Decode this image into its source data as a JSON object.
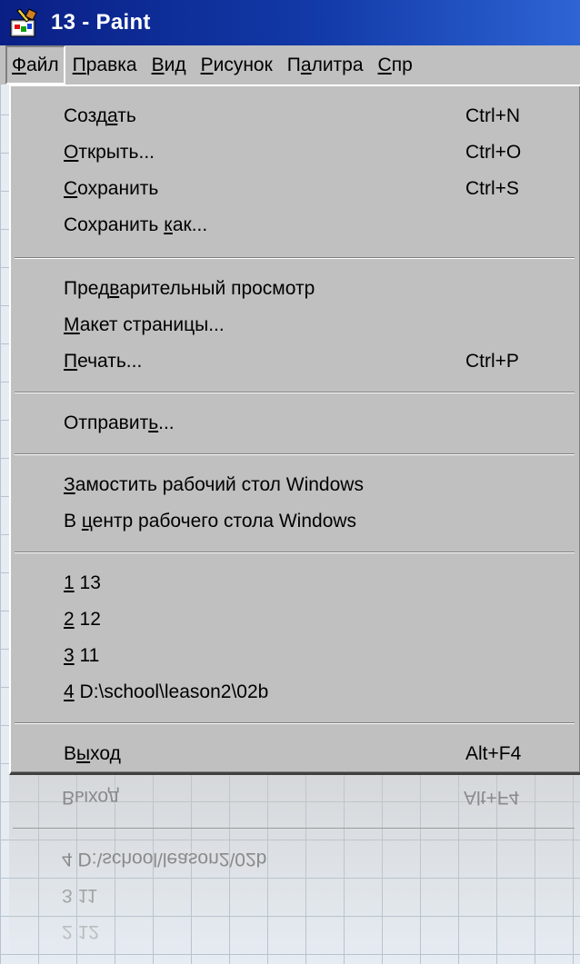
{
  "window": {
    "title": "13 - Paint",
    "icon": "paint-app-icon"
  },
  "menubar": {
    "items": [
      {
        "pre": "",
        "key": "Ф",
        "post": "айл"
      },
      {
        "pre": "",
        "key": "П",
        "post": "равка"
      },
      {
        "pre": "",
        "key": "В",
        "post": "ид"
      },
      {
        "pre": "",
        "key": "Р",
        "post": "исунок"
      },
      {
        "pre": "П",
        "key": "а",
        "post": "литра"
      },
      {
        "pre": "",
        "key": "С",
        "post": "пр"
      }
    ]
  },
  "file_menu": {
    "items": [
      {
        "pre": "Созд",
        "key": "а",
        "post": "ть",
        "shortcut": "Ctrl+N"
      },
      {
        "pre": "",
        "key": "О",
        "post": "ткрыть...",
        "shortcut": "Ctrl+O"
      },
      {
        "pre": "",
        "key": "С",
        "post": "охранить",
        "shortcut": "Ctrl+S"
      },
      {
        "pre": "Сохранить ",
        "key": "к",
        "post": "ак...",
        "shortcut": ""
      },
      {
        "pre": "Пред",
        "key": "в",
        "post": "арительный просмотр",
        "shortcut": ""
      },
      {
        "pre": "",
        "key": "М",
        "post": "акет страницы...",
        "shortcut": ""
      },
      {
        "pre": "",
        "key": "П",
        "post": "ечать...",
        "shortcut": "Ctrl+P"
      },
      {
        "pre": "Отправит",
        "key": "ь",
        "post": "...",
        "shortcut": ""
      },
      {
        "pre": "",
        "key": "З",
        "post": "амостить рабочий стол Windows",
        "shortcut": ""
      },
      {
        "pre": "В ",
        "key": "ц",
        "post": "ентр рабочего стола Windows",
        "shortcut": ""
      },
      {
        "pre": "",
        "key": "1",
        "post": " 13",
        "shortcut": ""
      },
      {
        "pre": "",
        "key": "2",
        "post": " 12",
        "shortcut": ""
      },
      {
        "pre": "",
        "key": "3",
        "post": " 11",
        "shortcut": ""
      },
      {
        "pre": "",
        "key": "4",
        "post": " D:\\school\\leason2\\02b",
        "shortcut": ""
      },
      {
        "pre": "В",
        "key": "ы",
        "post": "ход",
        "shortcut": "Alt+F4"
      }
    ]
  },
  "colors": {
    "titlebar_start": "#0a1f85",
    "titlebar_end": "#2e64d4",
    "menu_face": "#c0c0c0",
    "background": "#e6ecf2"
  }
}
